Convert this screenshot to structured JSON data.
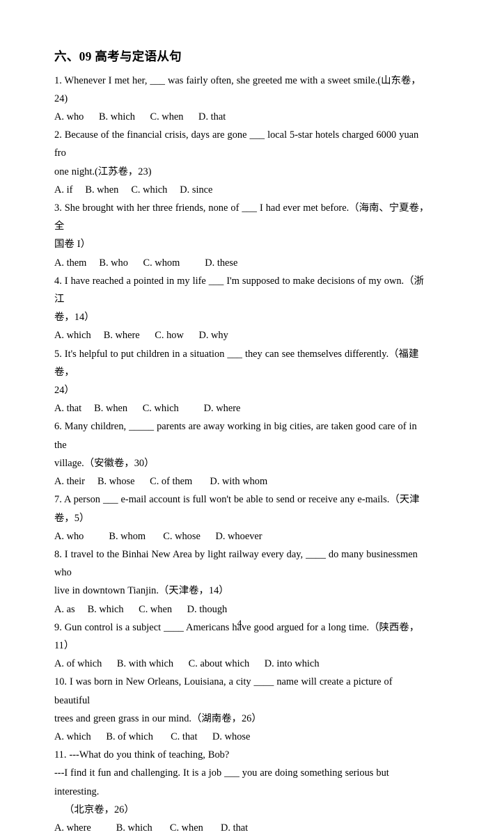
{
  "document": {
    "title": "六、09 高考与定语从句",
    "page_number": "4"
  },
  "questions": [
    {
      "id": "q1",
      "lines": [
        "1. Whenever I met her, ___ was fairly often, she greeted me with a sweet smile.(山东卷，24)"
      ],
      "options": "A. who      B. which      C. when      D. that"
    },
    {
      "id": "q2",
      "lines": [
        "2. Because of the financial crisis, days are gone ___ local 5-star hotels charged 6000 yuan fro",
        "one night.(江苏卷，23)"
      ],
      "options": "A. if     B. when     C. which     D. since"
    },
    {
      "id": "q3",
      "lines": [
        "3. She brought with her three friends, none of ___ I had ever met before.（海南、宁夏卷，全",
        "国卷 I）"
      ],
      "options": "A. them     B. who      C. whom          D. these"
    },
    {
      "id": "q4",
      "lines": [
        "4. I have reached a pointed in my life ___ I'm supposed to make decisions of my own.（浙江",
        "卷，14）"
      ],
      "options": "A. which     B. where      C. how      D. why"
    },
    {
      "id": "q5",
      "lines": [
        "5. It's helpful to put children in a situation ___ they can see themselves differently.（福建卷，",
        "24）"
      ],
      "options": "A. that     B. when      C. which          D. where"
    },
    {
      "id": "q6",
      "lines": [
        "6. Many children, _____ parents are away working in big cities, are taken good care of in the",
        "village.（安徽卷，30）"
      ],
      "options": "A. their     B. whose      C. of them       D. with whom"
    },
    {
      "id": "q7",
      "lines": [
        "7. A person ___ e-mail account is full won't be able to send or receive any e-mails.（天津卷，5）"
      ],
      "options": "A. who          B. whom       C. whose      D. whoever"
    },
    {
      "id": "q8",
      "lines": [
        "8. I travel to the Binhai New Area by light railway every day, ____ do many businessmen who",
        "live in downtown Tianjin.（天津卷，14）"
      ],
      "options": "A. as     B. which      C. when      D. though"
    },
    {
      "id": "q9",
      "lines": [
        "9. Gun control is a subject ____ Americans have good argued for a long time.（陕西卷，11）"
      ],
      "options": "A. of which      B. with which      C. about which      D. into which"
    },
    {
      "id": "q10",
      "lines": [
        "10. I was born in New Orleans, Louisiana, a city ____ name will create a picture of beautiful",
        "trees and green grass in our mind.（湖南卷，26）"
      ],
      "options": "A. which      B. of which       C. that      D. whose"
    },
    {
      "id": "q11",
      "lines": [
        "11. ---What do you think of teaching, Bob?",
        "---I find it fun and challenging. It is a job ___ you are doing something serious but interesting.",
        "（北京卷，26）"
      ],
      "options": "A. where          B. which       C. when       D. that"
    }
  ]
}
